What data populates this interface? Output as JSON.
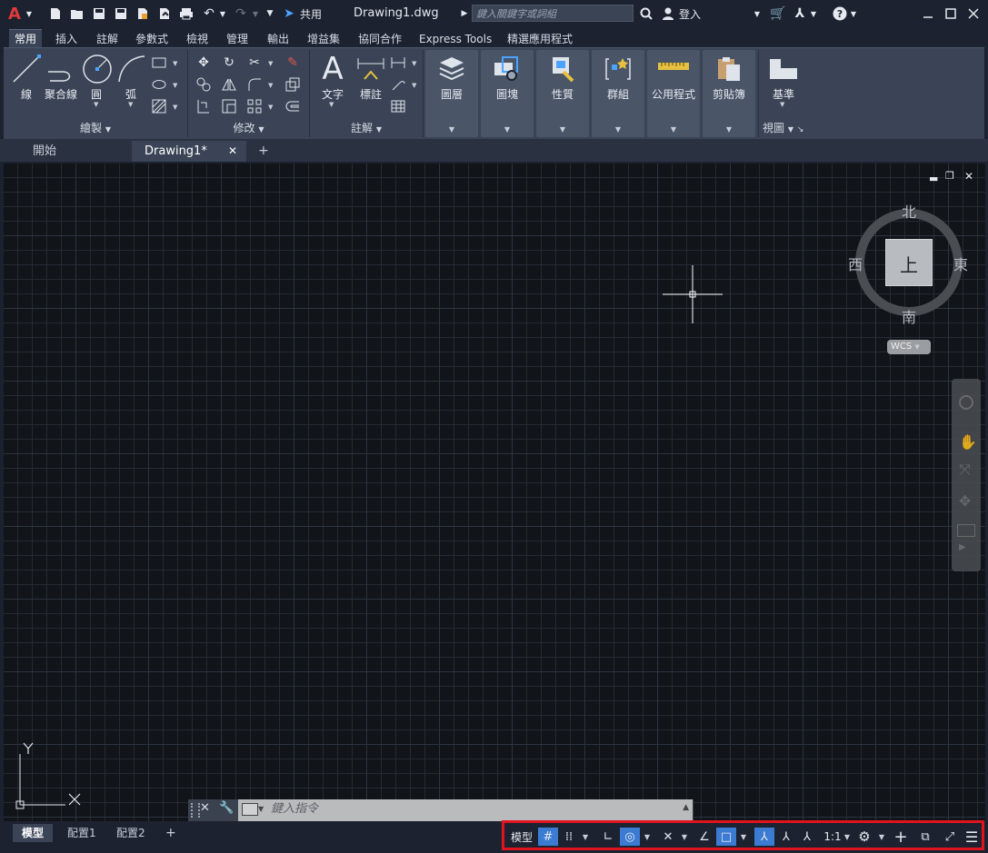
{
  "titlebar": {
    "app_logo": "A",
    "share_label": "共用",
    "filename": "Drawing1.dwg",
    "search_placeholder": "鍵入關鍵字或詞組",
    "signin_label": "登入"
  },
  "ribbon_tabs": [
    "常用",
    "插入",
    "註解",
    "參數式",
    "檢視",
    "管理",
    "輸出",
    "增益集",
    "協同合作",
    "Express Tools",
    "精選應用程式"
  ],
  "ribbon": {
    "draw": {
      "title": "繪製",
      "line": "線",
      "polyline": "聚合線",
      "circle": "圓",
      "arc": "弧"
    },
    "modify": {
      "title": "修改"
    },
    "annotation": {
      "title": "註解",
      "text": "文字",
      "dimension": "標註"
    },
    "layers": "圖層",
    "block": "圖塊",
    "properties": "性質",
    "groups": "群組",
    "utilities": "公用程式",
    "clipboard": "剪貼簿",
    "view": {
      "base": "基準",
      "title": "視圖"
    }
  },
  "doc_tabs": {
    "start": "開始",
    "drawing": "Drawing1*"
  },
  "viewcube": {
    "north": "北",
    "south": "南",
    "west": "西",
    "east": "東",
    "top": "上",
    "wcs": "WCS"
  },
  "ucs": {
    "x": "X",
    "y": "Y"
  },
  "command": {
    "placeholder": "鍵入指令"
  },
  "layout_tabs": [
    "模型",
    "配置1",
    "配置2"
  ],
  "statusbar": {
    "model": "模型",
    "scale": "1:1"
  }
}
